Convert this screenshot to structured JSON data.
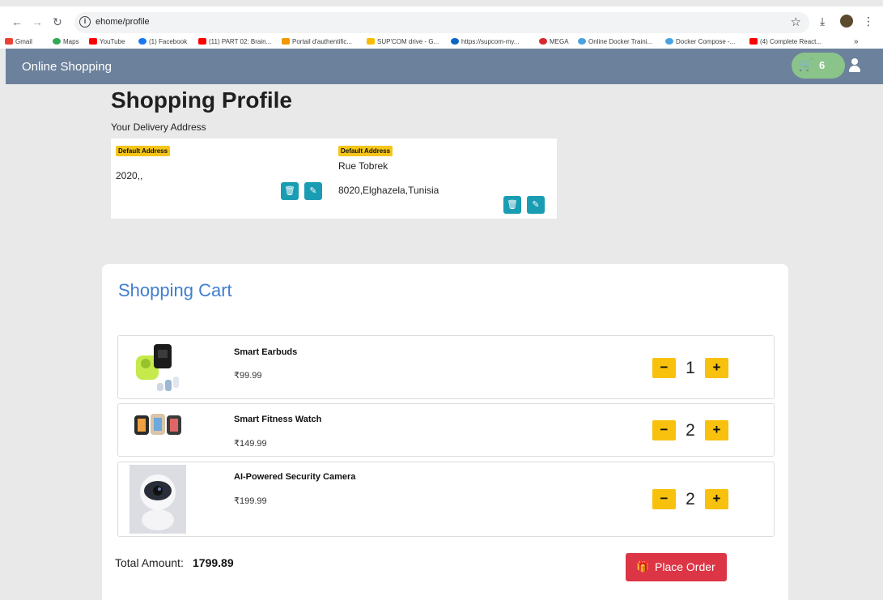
{
  "browser": {
    "url": "ehome/profile",
    "bookmarks": [
      "Gmail",
      "Maps",
      "YouTube",
      "(1) Facebook",
      "(11) PART 02: Brain...",
      "Portail d'authentific...",
      "SUP'COM drive - G...",
      "https://supcom-my...",
      "MEGA",
      "Online Docker Traini...",
      "Docker Compose -...",
      "(4) Complete React..."
    ],
    "more_label": "»"
  },
  "navbar": {
    "brand": "Online Shopping",
    "cart_count": "6"
  },
  "profile": {
    "title": "Shopping Profile",
    "subtitle": "Your Delivery Address",
    "addresses": [
      {
        "badge": "Default Address",
        "line1": "2020,,",
        "line2": ""
      },
      {
        "badge": "Default Address",
        "line1": "Rue Tobrek",
        "line2": "8020,Elghazela,Tunisia"
      }
    ]
  },
  "cart": {
    "title": "Shopping Cart",
    "items": [
      {
        "name": "Smart Earbuds",
        "price": "₹99.99",
        "qty": "1",
        "image": "earbuds-image"
      },
      {
        "name": "Smart Fitness Watch",
        "price": "₹149.99",
        "qty": "2",
        "image": "watch-image"
      },
      {
        "name": "AI-Powered Security Camera",
        "price": "₹199.99",
        "qty": "2",
        "image": "camera-image"
      }
    ],
    "minus": "−",
    "plus": "+",
    "total_label": "Total Amount:",
    "total_value": "1799.89",
    "place_order": "Place Order"
  },
  "colors": {
    "navbar": "#6c819b",
    "cart_pill": "#8bc48a",
    "icon_btn": "#1a9db3",
    "qty_btn": "#f8c10d",
    "place_order": "#dc3545",
    "cart_title": "#3f7ecf"
  }
}
